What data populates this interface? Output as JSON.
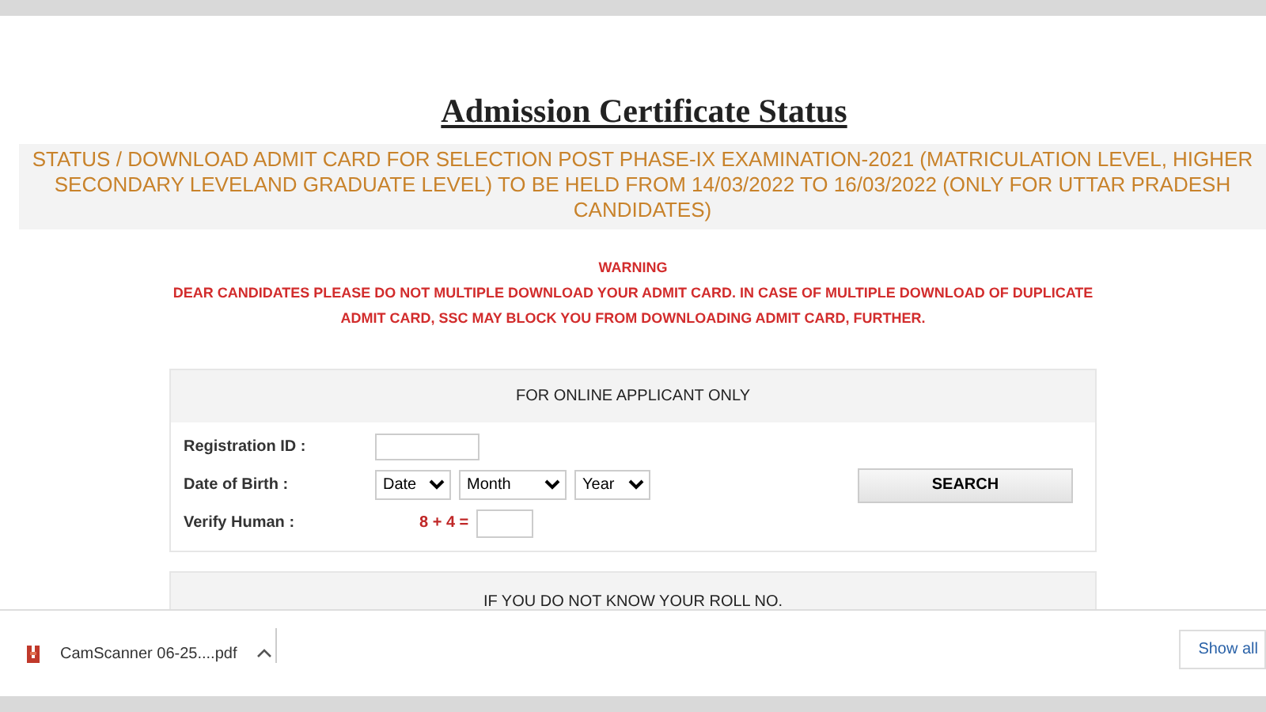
{
  "heading": "Admission Certificate Status",
  "notice": "STATUS / DOWNLOAD ADMIT CARD FOR SELECTION POST PHASE-IX EXAMINATION-2021 (MATRICULATION LEVEL, HIGHER SECONDARY LEVELAND GRADUATE LEVEL) TO BE HELD FROM 14/03/2022 TO 16/03/2022 (ONLY FOR UTTAR PRADESH CANDIDATES)",
  "warning": {
    "title": "WARNING",
    "text": "DEAR CANDIDATES PLEASE DO NOT MULTIPLE DOWNLOAD YOUR ADMIT CARD. IN CASE OF MULTIPLE DOWNLOAD OF DUPLICATE ADMIT CARD, SSC MAY BLOCK YOU FROM DOWNLOADING ADMIT CARD, FURTHER."
  },
  "form": {
    "title": "FOR ONLINE APPLICANT ONLY",
    "registration_label": "Registration ID :",
    "dob_label": "Date of Birth :",
    "dob_selects": [
      "Date",
      "Month",
      "Year"
    ],
    "verify_label": "Verify Human :",
    "captcha": "8 + 4 =",
    "search_button": "SEARCH"
  },
  "second_panel": {
    "title": "IF YOU DO NOT KNOW YOUR ROLL NO."
  },
  "download_bar": {
    "file": "CamScanner 06-25....pdf",
    "show_all": "Show all"
  }
}
